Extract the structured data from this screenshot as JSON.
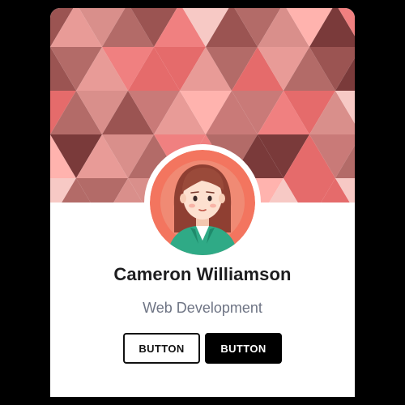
{
  "profile": {
    "name": "Cameron Williamson",
    "role": "Web Development"
  },
  "actions": {
    "primary_label": "BUTTON",
    "secondary_label": "BUTTON"
  },
  "colors": {
    "banner_palette": [
      "#f08080",
      "#e89b97",
      "#d98f8b",
      "#c97a78",
      "#b36b68",
      "#9b5452",
      "#7a3a3a",
      "#ffb3ae",
      "#f7c9c5",
      "#e56b6b"
    ],
    "avatar_bg": "#f3755f",
    "hair": "#9a4a3a",
    "skin": "#fde0cf",
    "shirt": "#2faa86",
    "button_solid": "#000000",
    "name_text": "#1d1d1f",
    "role_text": "#6e7484"
  },
  "icons": {
    "avatar": "woman-avatar-illustration"
  }
}
